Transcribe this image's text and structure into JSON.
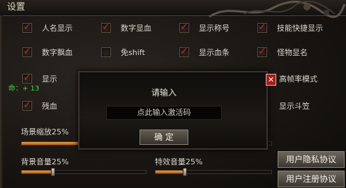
{
  "window": {
    "title": "设置"
  },
  "options": [
    {
      "label": "人名显示",
      "checked": true
    },
    {
      "label": "数字显血",
      "checked": true
    },
    {
      "label": "显示称号",
      "checked": true
    },
    {
      "label": "技能快捷显示",
      "checked": true
    },
    {
      "label": "数字飘血",
      "checked": true
    },
    {
      "label": "免shift",
      "checked": false
    },
    {
      "label": "显示血条",
      "checked": true
    },
    {
      "label": "怪物显名",
      "checked": true
    },
    {
      "label": "显示",
      "checked": true
    },
    {
      "label": "高帧率模式"
    },
    {
      "label": "残血",
      "checked": true
    },
    {
      "label": "显示斗笠"
    }
  ],
  "floating_text": "命：+ 13",
  "modal": {
    "title": "请输入",
    "input_placeholder": "点此输入激活码",
    "confirm_label": "确 定",
    "close_icon": "close-icon"
  },
  "sliders": {
    "scene_zoom": {
      "label": "场景缩放25%",
      "value": 25
    },
    "bg_volume": {
      "label": "背景音量25%",
      "value": 25
    },
    "fx_volume": {
      "label": "特效音量25%",
      "value": 25
    }
  },
  "agreements": {
    "privacy_label": "用户隐私协议",
    "register_label": "用户注册协议"
  },
  "colors": {
    "check_mark": "#c6262b",
    "slider_fill": "#e08a2a",
    "floating_text": "#3fd44f",
    "close_button": "#a61d1d"
  }
}
